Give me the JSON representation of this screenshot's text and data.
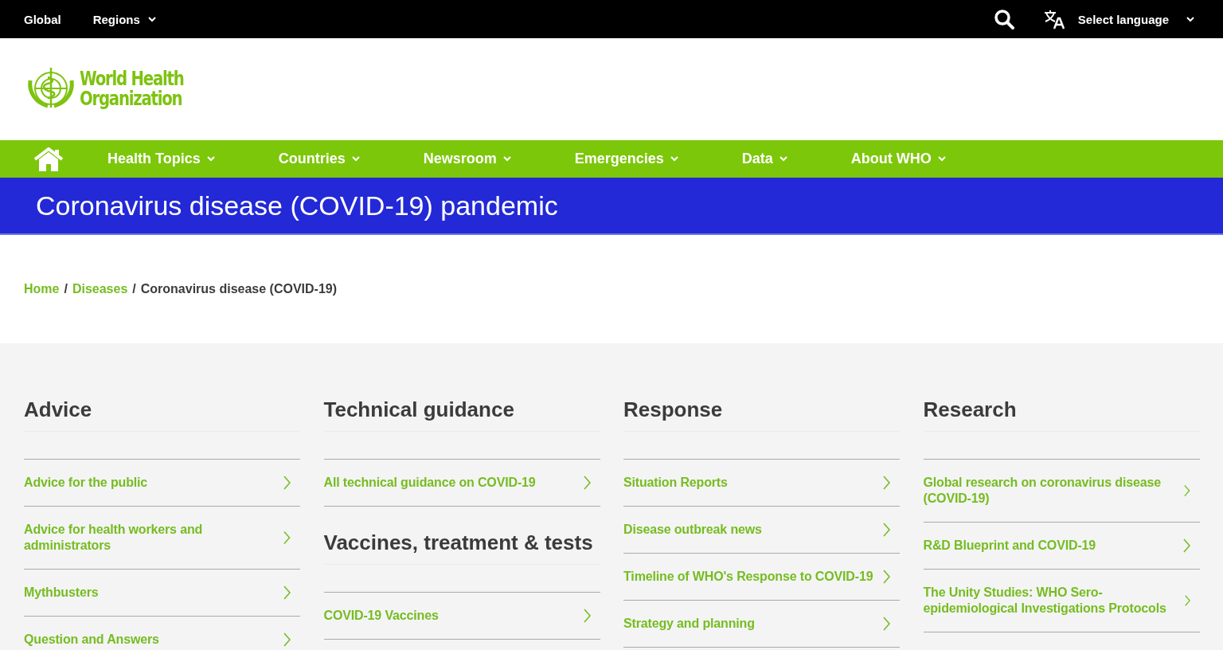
{
  "top_bar": {
    "global": "Global",
    "regions": "Regions",
    "language": "Select language"
  },
  "logo": {
    "lines": [
      "World Health",
      "Organization"
    ]
  },
  "main_nav": [
    {
      "label": "Health Topics"
    },
    {
      "label": "Countries"
    },
    {
      "label": "Newsroom"
    },
    {
      "label": "Emergencies"
    },
    {
      "label": "Data"
    },
    {
      "label": "About WHO"
    }
  ],
  "page_title": "Coronavirus disease (COVID-19) pandemic",
  "breadcrumb": [
    {
      "kind": "link",
      "label": "Home"
    },
    {
      "kind": "separator",
      "label": "/"
    },
    {
      "kind": "link",
      "label": "Diseases"
    },
    {
      "kind": "separator",
      "label": "/"
    },
    {
      "kind": "current",
      "label": "Coronavirus disease (COVID-19)"
    }
  ],
  "columns": [
    {
      "sections": [
        {
          "heading": "Advice",
          "links": [
            "Advice for the public",
            "Advice for health workers and administrators",
            "Mythbusters",
            "Question and Answers"
          ]
        }
      ]
    },
    {
      "sections": [
        {
          "heading": "Technical guidance",
          "links": [
            "All technical guidance on COVID-19"
          ]
        },
        {
          "heading": "Vaccines, treatment & tests",
          "links": [
            "COVID-19 Vaccines"
          ]
        }
      ]
    },
    {
      "sections": [
        {
          "heading": "Response",
          "links": [
            "Situation Reports",
            "Disease outbreak news",
            "Timeline of WHO's Response to COVID-19",
            "Strategy and planning"
          ]
        }
      ]
    },
    {
      "sections": [
        {
          "heading": "Research",
          "links": [
            "Global research on coronavirus disease (COVID-19)",
            "R&D Blueprint and COVID-19",
            "The Unity Studies: WHO Sero-epidemiological Investigations Protocols"
          ]
        }
      ]
    }
  ]
}
